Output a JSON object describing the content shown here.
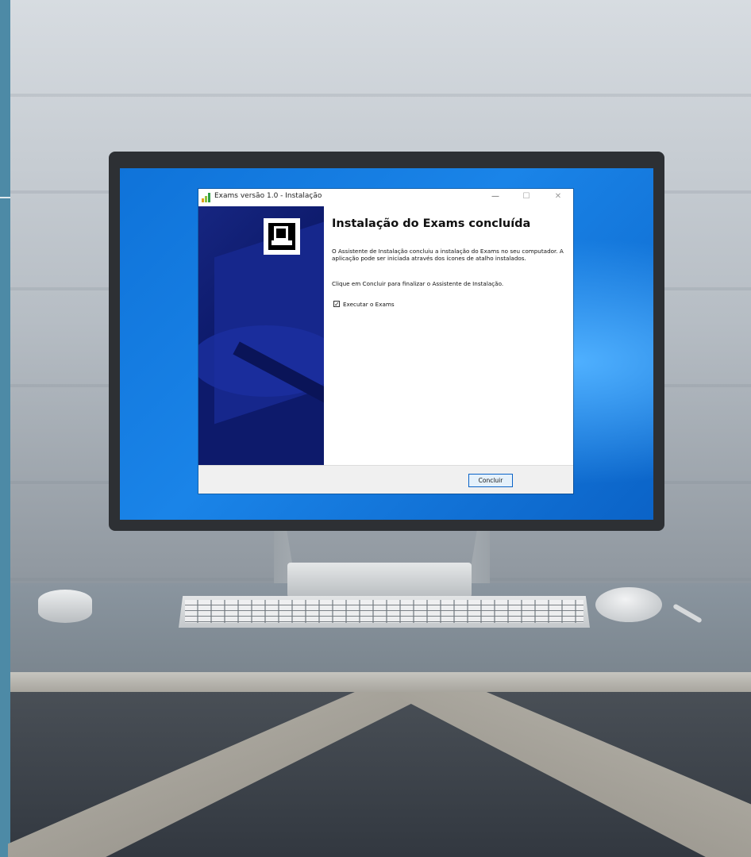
{
  "window": {
    "title": "Exams versão 1.0 - Instalação",
    "controls": {
      "minimize": "—",
      "maximize": "☐",
      "close": "✕"
    }
  },
  "content": {
    "heading": "Instalação do Exams concluída",
    "paragraph1": "O Assistente de Instalação concluiu a instalação do Exams no seu computador. A aplicação pode ser iniciada através dos ícones de atalho instalados.",
    "paragraph2": "Clique em Concluir para finalizar o Assistente de Instalação.",
    "checkbox": {
      "label": "Executar o Exams",
      "checked": true,
      "mark": "✓"
    }
  },
  "footer": {
    "finish_label": "Concluir"
  },
  "colors": {
    "side_panel": "#0d1a6b",
    "desktop_blue": "#1a84e8",
    "button_border": "#0a63c7",
    "icon_bars": [
      "#e0a21b",
      "#8cc43c",
      "#2f9e44"
    ]
  },
  "icons": {
    "app": "bar-chart-icon",
    "panel_logo": "installer-computer-icon"
  }
}
